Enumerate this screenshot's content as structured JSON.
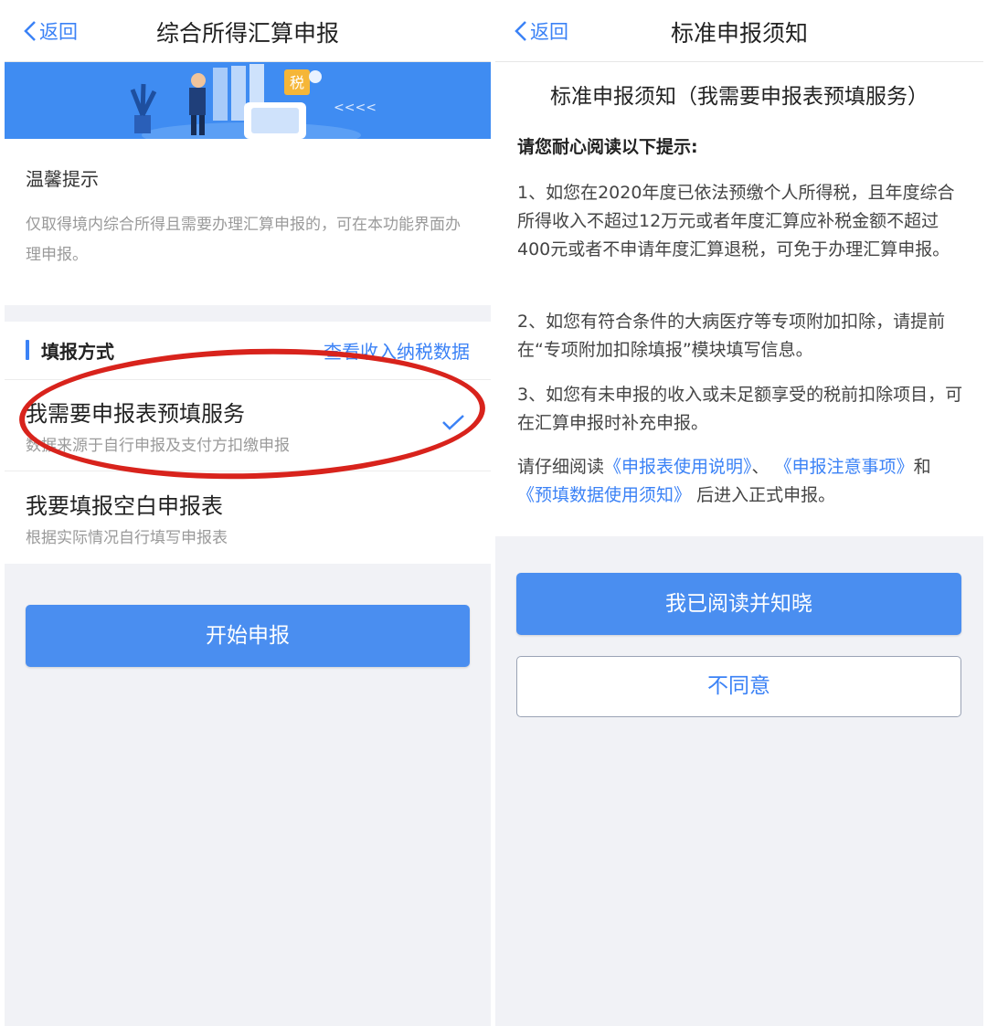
{
  "left": {
    "nav": {
      "back_label": "返回",
      "title": "综合所得汇算申报"
    },
    "banner": {
      "tax_tag": "税",
      "arrows": "<<<<"
    },
    "tip": {
      "title": "温馨提示",
      "body": "仅取得境内综合所得且需要办理汇算申报的，可在本功能界面办理申报。"
    },
    "fill_method": {
      "title": "填报方式",
      "link": "查看收入纳税数据",
      "options": [
        {
          "title": "我需要申报表预填服务",
          "subtitle": "数据来源于自行申报及支付方扣缴申报",
          "selected": true
        },
        {
          "title": "我要填报空白申报表",
          "subtitle": "根据实际情况自行填写申报表",
          "selected": false
        }
      ]
    },
    "start_button": "开始申报",
    "highlight_color": "#d8231c"
  },
  "right": {
    "nav": {
      "back_label": "返回",
      "title": "标准申报须知"
    },
    "notice": {
      "title": "标准申报须知（我需要申报表预填服务）",
      "lead": "请您耐心阅读以下提示:",
      "items": [
        "1、如您在2020年度已依法预缴个人所得税，且年度综合所得收入不超过12万元或者年度汇算应补税金额不超过400元或者不申请年度汇算退税，可免于办理汇算申报。",
        "2、如您有符合条件的大病医疗等专项附加扣除，请提前在“专项附加扣除填报”模块填写信息。",
        "3、如您有未申报的收入或未足额享受的税前扣除项目，可在汇算申报时补充申报。"
      ],
      "read_prefix": "请仔细阅读",
      "link1": "《申报表使用说明》",
      "sep1": "、",
      "link2": "《申报注意事项》",
      "sep2": "和",
      "link3": "《预填数据使用须知》",
      "read_suffix": "后进入正式申报。"
    },
    "ack_button": "我已阅读并知晓",
    "disagree_button": "不同意"
  },
  "colors": {
    "accent": "#3b82f6",
    "button": "#4a8ef0",
    "background": "#f1f2f6"
  }
}
